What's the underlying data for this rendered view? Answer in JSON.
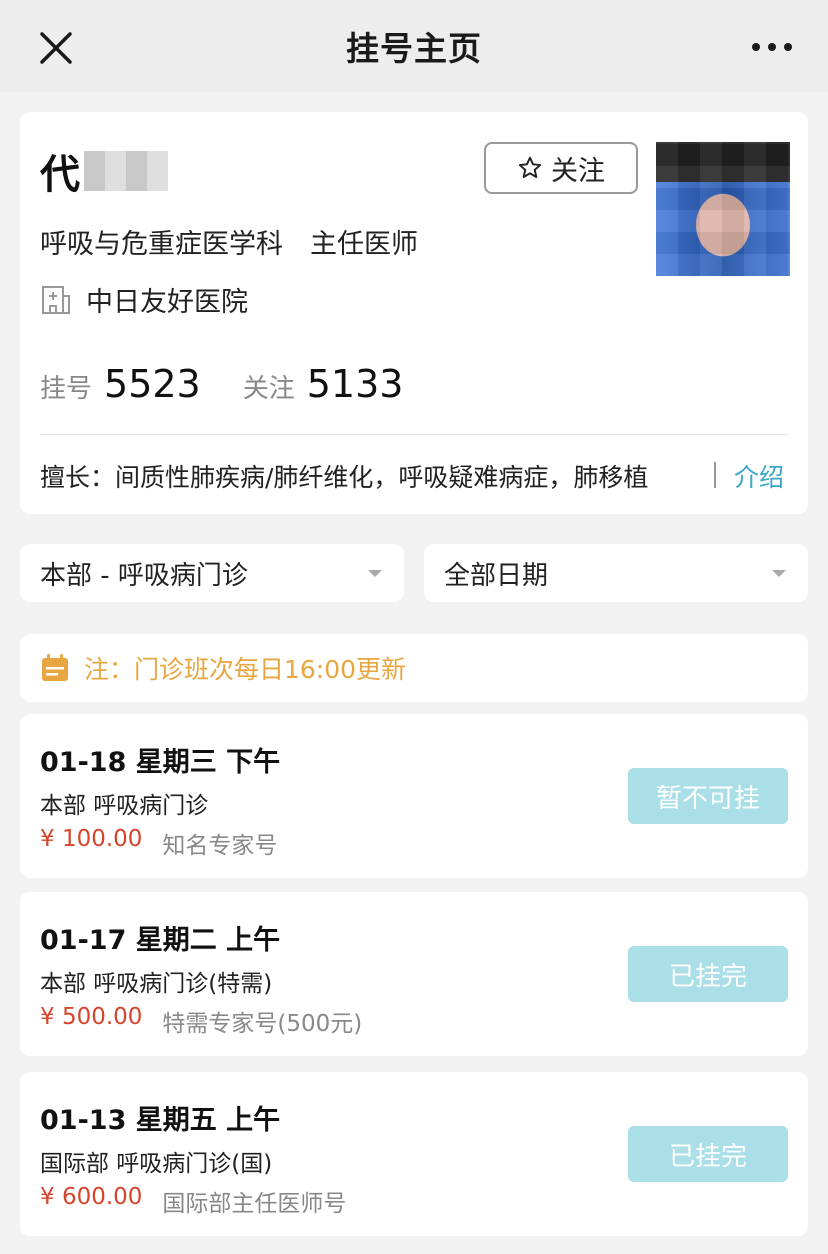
{
  "topbar": {
    "title": "挂号主页",
    "close_icon": "close-icon",
    "more_icon": "more-icon"
  },
  "doctor": {
    "name": "代",
    "follow_label": "关注",
    "department_title": "呼吸与危重症医学科　主任医师",
    "hospital": "中日友好医院",
    "stats": [
      {
        "label": "挂号",
        "value": "5523"
      },
      {
        "label": "关注",
        "value": "5133"
      }
    ],
    "specialty": "擅长：间质性肺疾病/肺纤维化，呼吸疑难病症，肺移植",
    "intro_label": "介绍"
  },
  "filters": {
    "location": "本部 - 呼吸病门诊",
    "date": "全部日期"
  },
  "notice": "注：门诊班次每日16:00更新",
  "colors": {
    "accent": "#3aa7c9",
    "price": "#d6452b",
    "notice": "#e8a640",
    "button_disabled": "#aadfe8"
  },
  "slots": [
    {
      "date": "01-18 星期三 下午",
      "dept": "本部 呼吸病门诊",
      "price": "¥ 100.00",
      "type": "知名专家号",
      "status": "暂不可挂"
    },
    {
      "date": "01-17 星期二 上午",
      "dept": "本部 呼吸病门诊(特需)",
      "price": "¥ 500.00",
      "type": "特需专家号(500元)",
      "status": "已挂完"
    },
    {
      "date": "01-13 星期五 上午",
      "dept": "国际部 呼吸病门诊(国)",
      "price": "¥ 600.00",
      "type": "国际部主任医师号",
      "status": "已挂完"
    }
  ]
}
